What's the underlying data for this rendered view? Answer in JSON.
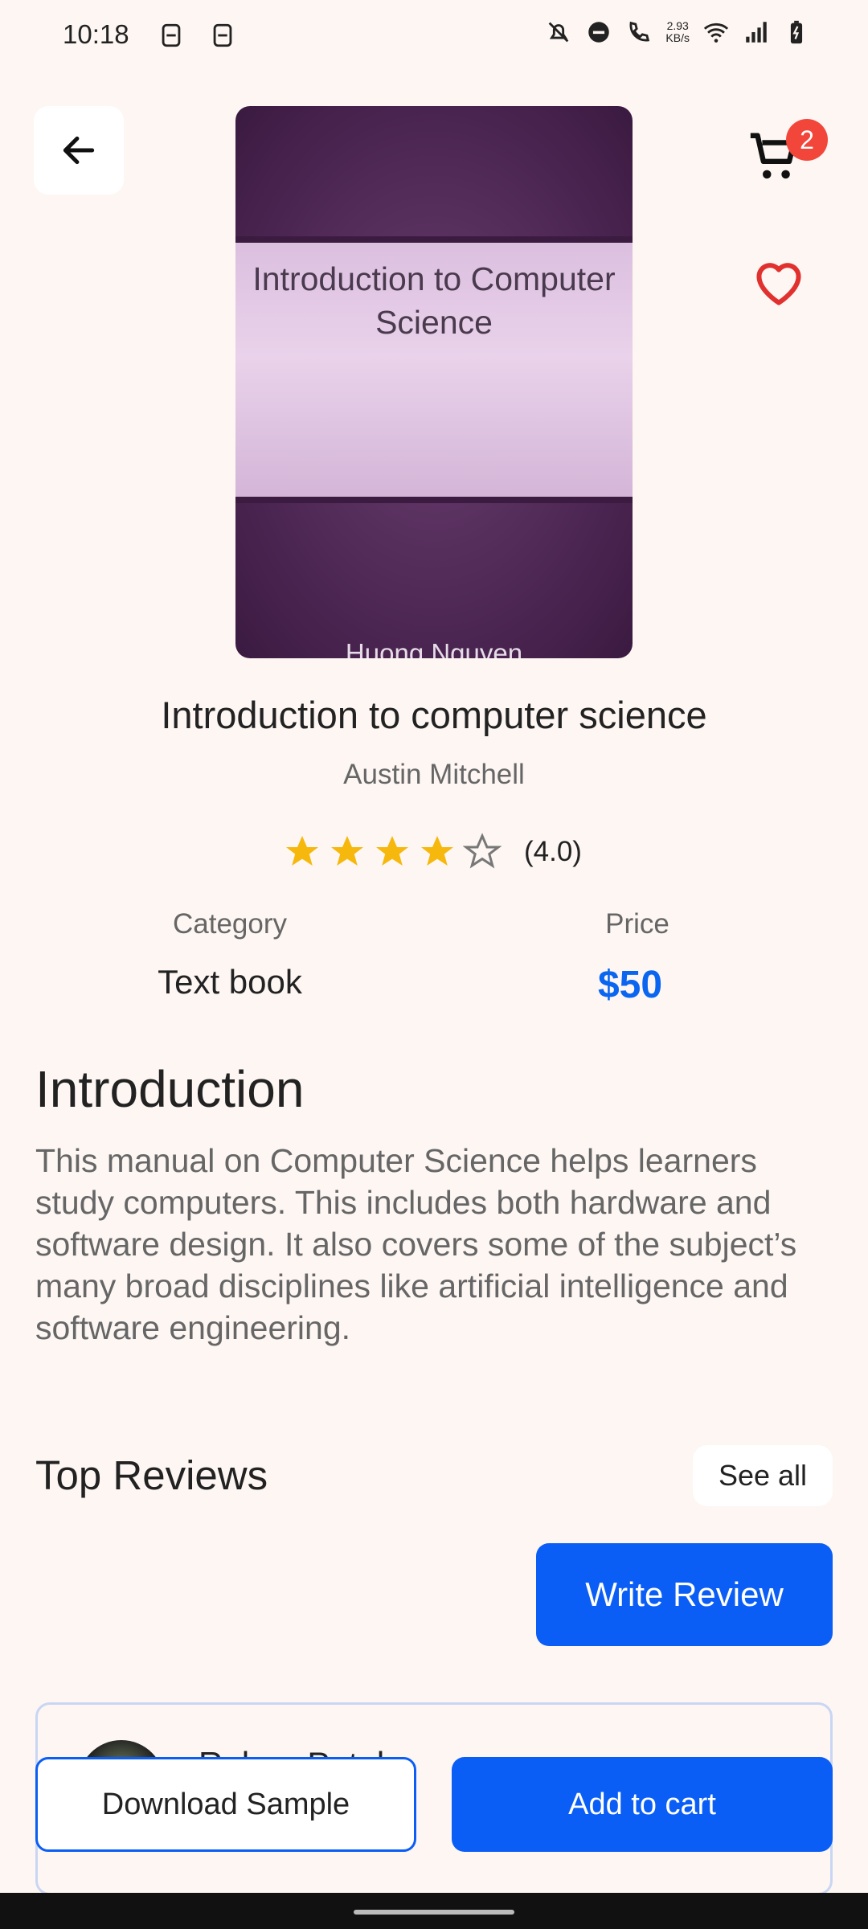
{
  "status_bar": {
    "time": "10:18",
    "net_speed_value": "2.93",
    "net_speed_unit": "KB/s",
    "icons": [
      "sim-icon",
      "sim-icon",
      "mute-icon",
      "dnd-icon",
      "wifi-call-icon",
      "wifi-icon",
      "signal-icon",
      "battery-icon"
    ]
  },
  "header": {
    "cart_count": "2",
    "icons": {
      "back": "arrow-left-icon",
      "cart": "cart-icon",
      "favorite": "heart-outline-icon"
    }
  },
  "cover": {
    "title": "Introduction to Computer Science",
    "author": "Huong Nguyen"
  },
  "book": {
    "title": "Introduction to computer science",
    "author": "Austin Mitchell",
    "rating": 4,
    "rating_text": "(4.0)",
    "category_label": "Category",
    "category_value": "Text book",
    "price_label": "Price",
    "price_value": "$50"
  },
  "intro": {
    "heading": "Introduction",
    "text": "This manual on Computer Science helps learners study computers. This includes both hardware and software design. It also covers some of the subject’s many broad disciplines like artificial intelligence and software engineering."
  },
  "reviews": {
    "heading": "Top Reviews",
    "see_all": "See all",
    "write_review": "Write Review",
    "first_reviewer": "Rohan Patel"
  },
  "actions": {
    "download": "Download Sample",
    "add_to_cart": "Add to cart"
  },
  "colors": {
    "accent": "#0a5ef5",
    "price": "#0a66f0",
    "star": "#f6b80c",
    "heart": "#e0312f",
    "badge": "#f2463b",
    "background": "#fdf6f3"
  }
}
